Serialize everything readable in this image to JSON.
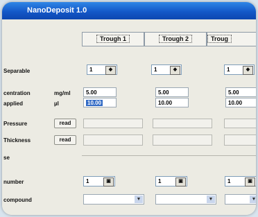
{
  "window": {
    "title": "NanoDeposit 1.0"
  },
  "tabs": [
    {
      "label": "Trough 1"
    },
    {
      "label": "Trough 2"
    },
    {
      "label": "Troug"
    }
  ],
  "rows": {
    "separable": {
      "label": "Separable",
      "values": [
        "1",
        "1",
        "1"
      ]
    },
    "concentration": {
      "label": "centration",
      "unit": "mg/ml",
      "values": [
        "5.00",
        "5.00",
        "5.00"
      ]
    },
    "applied": {
      "label": "applied",
      "unit": "µl",
      "values": [
        "10.00",
        "10.00",
        "10.00"
      ]
    },
    "pressure": {
      "label": "Pressure",
      "button": "read"
    },
    "thickness": {
      "label": "Thickness",
      "button": "read"
    },
    "section": {
      "label": "se"
    },
    "number": {
      "label": "number",
      "values": [
        "1",
        "1",
        "1"
      ]
    },
    "compound": {
      "label": "compound"
    }
  },
  "icons": {
    "spin": "spin-arrows-icon",
    "dropdown": "chevron-down-icon"
  }
}
